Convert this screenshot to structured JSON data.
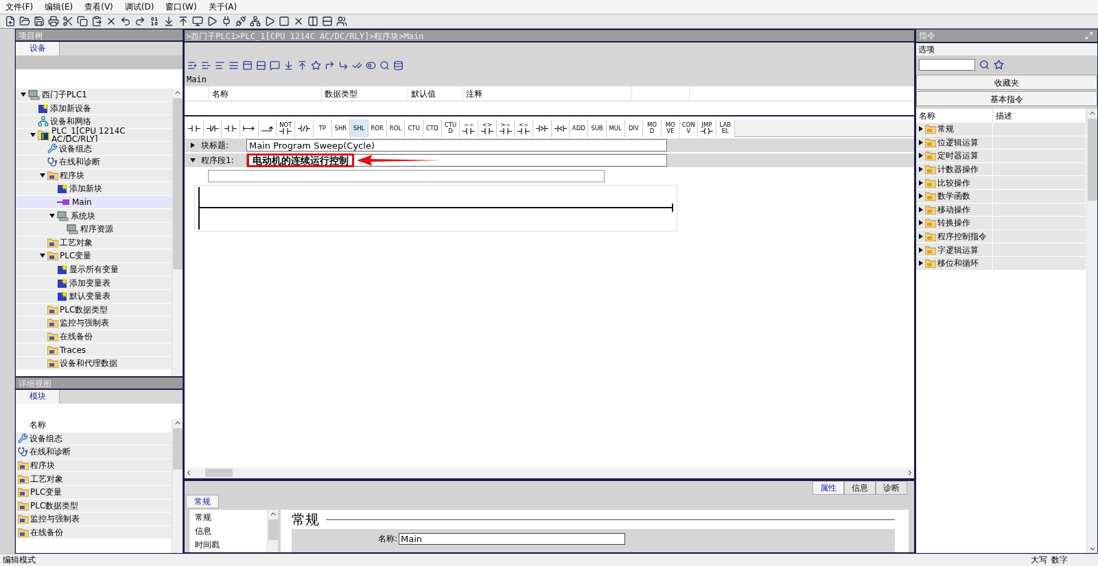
{
  "menu": [
    "文件(F)",
    "编辑(E)",
    "查看(V)",
    "调试(D)",
    "窗口(W)",
    "关于(A)"
  ],
  "project_tree": {
    "title": "项目树",
    "tabs": [
      {
        "label": "设备",
        "selected": true
      }
    ],
    "items": [
      {
        "name": "西门子PLC1",
        "kind": "station",
        "selected": false,
        "expanded": true,
        "children": [
          {
            "name": "添加新设备",
            "kind": "add",
            "selected": false
          },
          {
            "name": "设备和网络",
            "kind": "network",
            "selected": false
          },
          {
            "name": "PLC_1[CPU 1214C AC/DC/RLY]",
            "kind": "cpu",
            "selected": false,
            "expanded": true,
            "children": [
              {
                "name": "设备组态",
                "kind": "config",
                "selected": false
              },
              {
                "name": "在线和诊断",
                "kind": "diag",
                "selected": false
              },
              {
                "name": "程序块",
                "kind": "folder",
                "selected": false,
                "expanded": true,
                "children": [
                  {
                    "name": "添加新块",
                    "kind": "add",
                    "selected": false
                  },
                  {
                    "name": "Main",
                    "kind": "block",
                    "selected": true
                  },
                  {
                    "name": "系统块",
                    "kind": "system",
                    "selected": false,
                    "expanded": true,
                    "children": [
                      {
                        "name": "程序资源",
                        "kind": "system",
                        "selected": false
                      }
                    ]
                  }
                ]
              },
              {
                "name": "工艺对象",
                "kind": "folder",
                "selected": false
              },
              {
                "name": "PLC变量",
                "kind": "folder",
                "selected": false,
                "expanded": true,
                "children": [
                  {
                    "name": "显示所有变量",
                    "kind": "add",
                    "selected": false
                  },
                  {
                    "name": "添加变量表",
                    "kind": "add",
                    "selected": false
                  },
                  {
                    "name": "默认变量表",
                    "kind": "add",
                    "selected": false
                  }
                ]
              },
              {
                "name": "PLC数据类型",
                "kind": "folder",
                "selected": false
              },
              {
                "name": "监控与强制表",
                "kind": "folder",
                "selected": false
              },
              {
                "name": "在线备份",
                "kind": "folder",
                "selected": false
              },
              {
                "name": "Traces",
                "kind": "folder",
                "selected": false
              },
              {
                "name": "设备和代理数据",
                "kind": "folder",
                "selected": false
              }
            ]
          }
        ]
      }
    ]
  },
  "detail_view": {
    "title": "详细视图",
    "tabs": [
      {
        "label": "模块",
        "selected": true
      }
    ],
    "column": "名称",
    "rows": [
      {
        "name": "设备组态",
        "kind": "config"
      },
      {
        "name": "在线和诊断",
        "kind": "diag"
      },
      {
        "name": "程序块",
        "kind": "folder"
      },
      {
        "name": "工艺对象",
        "kind": "folder"
      },
      {
        "name": "PLC变量",
        "kind": "folder"
      },
      {
        "name": "PLC数据类型",
        "kind": "folder"
      },
      {
        "name": "监控与强制表",
        "kind": "folder"
      },
      {
        "name": "在线备份",
        "kind": "folder"
      }
    ]
  },
  "editor": {
    "breadcrumb": ">西门子PLC1>PLC_1[CPU 1214C AC/DC/RLY]>程序块>Main",
    "block_name": "Main",
    "interface_columns": [
      "名称",
      "数据类型",
      "默认值",
      "注释"
    ],
    "instructions": [
      {
        "kind": "contact",
        "selected": false
      },
      {
        "kind": "nc",
        "selected": false
      },
      {
        "kind": "coil",
        "selected": false
      },
      {
        "kind": "open",
        "selected": false
      },
      {
        "kind": "close",
        "selected": false
      },
      {
        "label": "NOT",
        "kind": "contact",
        "selected": false
      },
      {
        "kind": "ncoil",
        "selected": false
      },
      {
        "label": "TP",
        "selected": false
      },
      {
        "label": "SHR",
        "selected": false
      },
      {
        "label": "SHL",
        "selected": true
      },
      {
        "label": "ROR",
        "selected": false
      },
      {
        "label": "ROL",
        "selected": false
      },
      {
        "label": "CTU",
        "selected": false
      },
      {
        "label": "CTD",
        "selected": false
      },
      {
        "label": "CTU\nD",
        "selected": false
      },
      {
        "label": "==",
        "kind": "contact",
        "selected": false
      },
      {
        "label": "<>",
        "kind": "contact",
        "selected": false
      },
      {
        "label": ">=",
        "kind": "contact",
        "selected": false
      },
      {
        "label": "<=",
        "kind": "contact",
        "selected": false
      },
      {
        "kind": "gt",
        "selected": false
      },
      {
        "kind": "lt",
        "selected": false
      },
      {
        "label": "ADD",
        "selected": false
      },
      {
        "label": "SUB",
        "selected": false
      },
      {
        "label": "MUL",
        "selected": false
      },
      {
        "label": "DIV",
        "selected": false
      },
      {
        "label": "MO\nD",
        "selected": false
      },
      {
        "label": "MO\nVE",
        "selected": false
      },
      {
        "label": "CON\nV",
        "selected": false
      },
      {
        "label": "JMP",
        "kind": "coil",
        "selected": false
      },
      {
        "label": "LAB\nEL",
        "selected": false
      }
    ],
    "block_title": {
      "label": "块标题:",
      "value": "Main Program Sweep(Cycle)",
      "expanded": false
    },
    "network": {
      "label": "程序段1:",
      "title": "电动机的连续运行控制",
      "expanded": true,
      "highlighted": true
    }
  },
  "inspector": {
    "tabs": [
      {
        "label": "属性",
        "selected": true
      },
      {
        "label": "信息",
        "selected": false
      },
      {
        "label": "诊断",
        "selected": false
      }
    ],
    "section_tabs": [
      {
        "label": "常规",
        "selected": true
      }
    ],
    "nav": [
      "常规",
      "信息",
      "时间戳"
    ],
    "heading": "常规",
    "fields": [
      {
        "label": "名称:",
        "value": "Main"
      }
    ]
  },
  "instructions_panel": {
    "title": "指令",
    "options": "选项",
    "favorites": "收藏夹",
    "basic": "基本指令",
    "columns": [
      "名称",
      "描述"
    ],
    "items": [
      {
        "name": "常规",
        "expanded": false
      },
      {
        "name": "位逻辑运算",
        "expanded": false
      },
      {
        "name": "定时器运算",
        "expanded": false
      },
      {
        "name": "计数器操作",
        "expanded": false
      },
      {
        "name": "比较操作",
        "expanded": false
      },
      {
        "name": "数学函数",
        "expanded": false
      },
      {
        "name": "移动操作",
        "expanded": false
      },
      {
        "name": "转换操作",
        "expanded": false
      },
      {
        "name": "程序控制指令",
        "expanded": false
      },
      {
        "name": "字逻辑运算",
        "expanded": false
      },
      {
        "name": "移位和循环",
        "expanded": false
      }
    ]
  },
  "status_bar": {
    "mode": "编辑模式",
    "indicators": [
      "大写",
      "数字"
    ]
  }
}
